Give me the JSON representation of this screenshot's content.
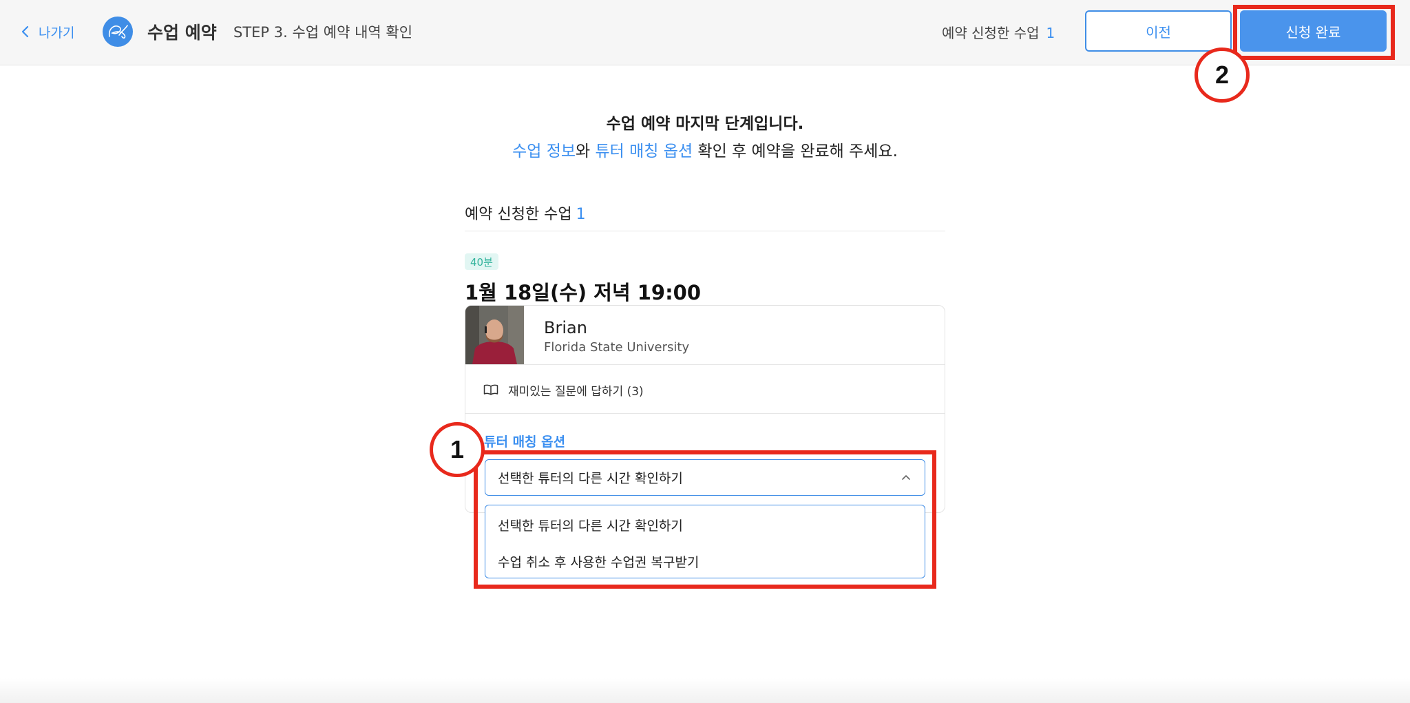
{
  "header": {
    "back_label": "나가기",
    "app_title": "수업 예약",
    "step_label": "STEP 3. 수업 예약 내역 확인",
    "count_label": "예약 신청한 수업",
    "count_value": "1",
    "prev_button": "이전",
    "done_button": "신청 완료"
  },
  "annotations": {
    "badge_1": "1",
    "badge_2": "2",
    "highlight_color": "#e8291c"
  },
  "intro": {
    "line1": "수업 예약 마지막 단계입니다.",
    "line2_part1": "수업 정보",
    "line2_part2": "와 ",
    "line2_part3": "튜터 매칭 옵션",
    "line2_part4": " 확인 후 예약을 완료해 주세요."
  },
  "section": {
    "title": "예약 신청한 수업",
    "count": "1"
  },
  "lesson": {
    "duration": "40분",
    "datetime": "1월 18일(수) 저녁 19:00",
    "tutor_name": "Brian",
    "tutor_school": "Florida State University",
    "course_title": "재미있는 질문에 답하기 (3)",
    "course_icon": "book-icon"
  },
  "matching": {
    "label": "튜터 매칭 옵션",
    "selected": "선택한 튜터의 다른 시간 확인하기",
    "options": [
      "선택한 튜터의 다른 시간 확인하기",
      "수업 취소 후 사용한 수업권 복구받기"
    ]
  },
  "colors": {
    "accent": "#3b8ff0",
    "primary_button": "#4a94ec",
    "duration_badge": "#33b39c"
  }
}
